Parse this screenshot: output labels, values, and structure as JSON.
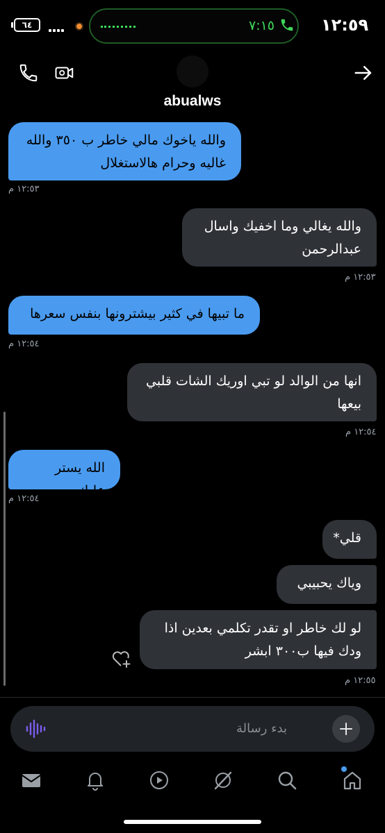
{
  "status_bar": {
    "time": "١٢:٥٩",
    "call_duration": "٧:١٥",
    "battery": "٦٤"
  },
  "header": {
    "username": "abualws"
  },
  "messages": [
    {
      "lines": [
        "والله ياخوك مالي خاطر ب ٣٥٠ والله",
        "غاليه وحرام هالاستغلال"
      ],
      "time": "١٢:٥٣ م"
    },
    {
      "lines": [
        "والله يغالي وما اخفيك واسال",
        "عبدالرحمن"
      ],
      "time": "١٢:٥٣ م"
    },
    {
      "lines": [
        "ما تبيها في كثير بيشترونها بنفس سعرها"
      ],
      "time": "١٢:٥٤ م"
    },
    {
      "lines": [
        "انها من الوالد لو تبي اوريك الشات قلبي",
        "بيعها"
      ],
      "time": "١٢:٥٤ م"
    },
    {
      "lines": [
        "الله يستر عليك"
      ],
      "time": "١٢:٥٤ م"
    },
    {
      "lines": [
        "قلي*"
      ]
    },
    {
      "lines": [
        "وياك يحبيبي"
      ]
    },
    {
      "lines": [
        "لو لك خاطر او تقدر تكلمي بعدين اذا",
        "ودك فيها ب٣٠٠ ابشر"
      ],
      "time": "١٢:٥٥ م"
    }
  ],
  "composer": {
    "placeholder": "بدء رسالة"
  },
  "colors": {
    "incoming": "#4a9bf0",
    "outgoing": "#2f3237",
    "background": "#000000",
    "call_green": "#3ed95a"
  },
  "icons": {
    "header": [
      "phone-icon",
      "video-call-icon",
      "back-arrow-icon"
    ],
    "nav": [
      "mail-icon",
      "bell-icon",
      "play-icon",
      "grok-icon",
      "search-icon",
      "home-icon"
    ]
  }
}
